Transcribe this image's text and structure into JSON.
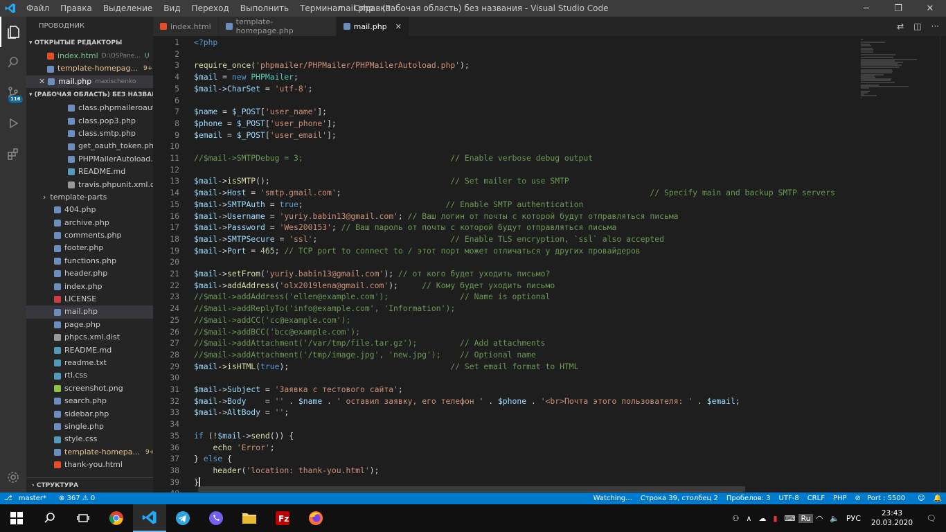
{
  "window": {
    "title": "mail.php - (Рабочая область) без названия - Visual Studio Code",
    "menu": [
      "Файл",
      "Правка",
      "Выделение",
      "Вид",
      "Переход",
      "Выполнить",
      "Терминал",
      "Справка"
    ]
  },
  "activity": {
    "scm_badge": "116"
  },
  "sidebar": {
    "title": "ПРОВОДНИК",
    "open_editors_title": "ОТКРЫТЫЕ РЕДАКТОРЫ",
    "open_editors": [
      {
        "name": "index.html",
        "path": "D:\\OSPane...",
        "badge": "U",
        "color": "#e44d26"
      },
      {
        "name": "template-homepag...",
        "path": "",
        "badge": "9+",
        "color": "#6c8ebf"
      },
      {
        "name": "mail.php",
        "path": "maxischenko",
        "badge": "",
        "color": "#6c8ebf"
      }
    ],
    "workspace_title": "(РАБОЧАЯ ОБЛАСТЬ) БЕЗ НАЗВАН...",
    "files": [
      {
        "name": "class.phpmaileroauthgo...",
        "indent": 60,
        "color": "#6c8ebf",
        "badge": ""
      },
      {
        "name": "class.pop3.php",
        "indent": 60,
        "color": "#6c8ebf",
        "badge": ""
      },
      {
        "name": "class.smtp.php",
        "indent": 60,
        "color": "#6c8ebf",
        "badge": ""
      },
      {
        "name": "get_oauth_token.php",
        "indent": 60,
        "color": "#6c8ebf",
        "badge": ""
      },
      {
        "name": "PHPMailerAutoload.php",
        "indent": 60,
        "color": "#6c8ebf",
        "badge": ""
      },
      {
        "name": "README.md",
        "indent": 60,
        "color": "#519aba",
        "badge": ""
      },
      {
        "name": "travis.phpunit.xml.dist",
        "indent": 60,
        "color": "#999",
        "badge": ""
      },
      {
        "name": "template-parts",
        "indent": 24,
        "color": "",
        "badge": "",
        "folder": true
      },
      {
        "name": "404.php",
        "indent": 40,
        "color": "#6c8ebf",
        "badge": ""
      },
      {
        "name": "archive.php",
        "indent": 40,
        "color": "#6c8ebf",
        "badge": ""
      },
      {
        "name": "comments.php",
        "indent": 40,
        "color": "#6c8ebf",
        "badge": ""
      },
      {
        "name": "footer.php",
        "indent": 40,
        "color": "#6c8ebf",
        "badge": ""
      },
      {
        "name": "functions.php",
        "indent": 40,
        "color": "#6c8ebf",
        "badge": ""
      },
      {
        "name": "header.php",
        "indent": 40,
        "color": "#6c8ebf",
        "badge": ""
      },
      {
        "name": "index.php",
        "indent": 40,
        "color": "#6c8ebf",
        "badge": ""
      },
      {
        "name": "LICENSE",
        "indent": 40,
        "color": "#cc3e44",
        "badge": ""
      },
      {
        "name": "mail.php",
        "indent": 40,
        "color": "#6c8ebf",
        "badge": "",
        "selected": true
      },
      {
        "name": "page.php",
        "indent": 40,
        "color": "#6c8ebf",
        "badge": ""
      },
      {
        "name": "phpcs.xml.dist",
        "indent": 40,
        "color": "#999",
        "badge": ""
      },
      {
        "name": "README.md",
        "indent": 40,
        "color": "#519aba",
        "badge": ""
      },
      {
        "name": "readme.txt",
        "indent": 40,
        "color": "#519aba",
        "badge": ""
      },
      {
        "name": "rtl.css",
        "indent": 40,
        "color": "#519aba",
        "badge": ""
      },
      {
        "name": "screenshot.png",
        "indent": 40,
        "color": "#8dc149",
        "badge": ""
      },
      {
        "name": "search.php",
        "indent": 40,
        "color": "#6c8ebf",
        "badge": ""
      },
      {
        "name": "sidebar.php",
        "indent": 40,
        "color": "#6c8ebf",
        "badge": ""
      },
      {
        "name": "single.php",
        "indent": 40,
        "color": "#6c8ebf",
        "badge": ""
      },
      {
        "name": "style.css",
        "indent": 40,
        "color": "#519aba",
        "badge": ""
      },
      {
        "name": "template-homepa...",
        "indent": 40,
        "color": "#6c8ebf",
        "badge": "9+",
        "dirty": true
      },
      {
        "name": "thank-you.html",
        "indent": 40,
        "color": "#e44d26",
        "badge": ""
      }
    ],
    "outline_title": "СТРУКТУРА"
  },
  "tabs": [
    {
      "label": "index.html",
      "color": "#e44d26",
      "active": false
    },
    {
      "label": "template-homepage.php",
      "color": "#6c8ebf",
      "active": false
    },
    {
      "label": "mail.php",
      "color": "#6c8ebf",
      "active": true
    }
  ],
  "editor": {
    "lines": [
      [
        [
          "k",
          "<?php"
        ]
      ],
      [],
      [
        [
          "f",
          "require_once"
        ],
        [
          "p",
          "("
        ],
        [
          "s",
          "'phpmailer/PHPMailer/PHPMailerAutoload.php'"
        ],
        [
          "p",
          ");"
        ]
      ],
      [
        [
          "v",
          "$mail"
        ],
        [
          "p",
          " = "
        ],
        [
          "k",
          "new"
        ],
        [
          "p",
          " "
        ],
        [
          "t",
          "PHPMailer"
        ],
        [
          "p",
          ";"
        ]
      ],
      [
        [
          "v",
          "$mail"
        ],
        [
          "p",
          "->"
        ],
        [
          "v",
          "CharSet"
        ],
        [
          "p",
          " = "
        ],
        [
          "s",
          "'utf-8'"
        ],
        [
          "p",
          ";"
        ]
      ],
      [],
      [
        [
          "v",
          "$name"
        ],
        [
          "p",
          " = "
        ],
        [
          "v",
          "$_POST"
        ],
        [
          "p",
          "["
        ],
        [
          "s",
          "'user_name'"
        ],
        [
          "p",
          "];"
        ]
      ],
      [
        [
          "v",
          "$phone"
        ],
        [
          "p",
          " = "
        ],
        [
          "v",
          "$_POST"
        ],
        [
          "p",
          "["
        ],
        [
          "s",
          "'user_phone'"
        ],
        [
          "p",
          "];"
        ]
      ],
      [
        [
          "v",
          "$email"
        ],
        [
          "p",
          " = "
        ],
        [
          "v",
          "$_POST"
        ],
        [
          "p",
          "["
        ],
        [
          "s",
          "'user_email'"
        ],
        [
          "p",
          "];"
        ]
      ],
      [],
      [
        [
          "c",
          "//$mail->SMTPDebug = 3;                               // Enable verbose debug output"
        ]
      ],
      [],
      [
        [
          "v",
          "$mail"
        ],
        [
          "p",
          "->"
        ],
        [
          "f",
          "isSMTP"
        ],
        [
          "p",
          "();                                      "
        ],
        [
          "c",
          "// Set mailer to use SMTP"
        ]
      ],
      [
        [
          "v",
          "$mail"
        ],
        [
          "p",
          "->"
        ],
        [
          "v",
          "Host"
        ],
        [
          "p",
          " = "
        ],
        [
          "s",
          "'smtp.gmail.com'"
        ],
        [
          "p",
          ";                                                                 "
        ],
        [
          "c",
          "// Specify main and backup SMTP servers"
        ]
      ],
      [
        [
          "v",
          "$mail"
        ],
        [
          "p",
          "->"
        ],
        [
          "v",
          "SMTPAuth"
        ],
        [
          "p",
          " = "
        ],
        [
          "k",
          "true"
        ],
        [
          "p",
          ";                              "
        ],
        [
          "c",
          "// Enable SMTP authentication"
        ]
      ],
      [
        [
          "v",
          "$mail"
        ],
        [
          "p",
          "->"
        ],
        [
          "v",
          "Username"
        ],
        [
          "p",
          " = "
        ],
        [
          "s",
          "'yuriy.babin13@gmail.com'"
        ],
        [
          "p",
          "; "
        ],
        [
          "c",
          "// Ваш логин от почты с которой будут отправляться письма"
        ]
      ],
      [
        [
          "v",
          "$mail"
        ],
        [
          "p",
          "->"
        ],
        [
          "v",
          "Password"
        ],
        [
          "p",
          " = "
        ],
        [
          "s",
          "'Wes200153'"
        ],
        [
          "p",
          "; "
        ],
        [
          "c",
          "// Ваш пароль от почты с которой будут отправляться письма"
        ]
      ],
      [
        [
          "v",
          "$mail"
        ],
        [
          "p",
          "->"
        ],
        [
          "v",
          "SMTPSecure"
        ],
        [
          "p",
          " = "
        ],
        [
          "s",
          "'ssl'"
        ],
        [
          "p",
          ";                            "
        ],
        [
          "c",
          "// Enable TLS encryption, `ssl` also accepted"
        ]
      ],
      [
        [
          "v",
          "$mail"
        ],
        [
          "p",
          "->"
        ],
        [
          "v",
          "Port"
        ],
        [
          "p",
          " = "
        ],
        [
          "n",
          "465"
        ],
        [
          "p",
          "; "
        ],
        [
          "c",
          "// TCP port to connect to / этот порт может отличаться у других провайдеров"
        ]
      ],
      [],
      [
        [
          "v",
          "$mail"
        ],
        [
          "p",
          "->"
        ],
        [
          "f",
          "setFrom"
        ],
        [
          "p",
          "("
        ],
        [
          "s",
          "'yuriy.babin13@gmail.com'"
        ],
        [
          "p",
          "); "
        ],
        [
          "c",
          "// от кого будет уходить письмо?"
        ]
      ],
      [
        [
          "v",
          "$mail"
        ],
        [
          "p",
          "->"
        ],
        [
          "f",
          "addAddress"
        ],
        [
          "p",
          "("
        ],
        [
          "s",
          "'olx2019lena@gmail.com'"
        ],
        [
          "p",
          ");     "
        ],
        [
          "c",
          "// Кому будет уходить письмо"
        ]
      ],
      [
        [
          "c",
          "//$mail->addAddress('ellen@example.com');               // Name is optional"
        ]
      ],
      [
        [
          "c",
          "//$mail->addReplyTo('info@example.com', 'Information');"
        ]
      ],
      [
        [
          "c",
          "//$mail->addCC('cc@example.com');"
        ]
      ],
      [
        [
          "c",
          "//$mail->addBCC('bcc@example.com');"
        ]
      ],
      [
        [
          "c",
          "//$mail->addAttachment('/var/tmp/file.tar.gz');         // Add attachments"
        ]
      ],
      [
        [
          "c",
          "//$mail->addAttachment('/tmp/image.jpg', 'new.jpg');    // Optional name"
        ]
      ],
      [
        [
          "v",
          "$mail"
        ],
        [
          "p",
          "->"
        ],
        [
          "f",
          "isHTML"
        ],
        [
          "p",
          "("
        ],
        [
          "k",
          "true"
        ],
        [
          "p",
          ");                                  "
        ],
        [
          "c",
          "// Set email format to HTML"
        ]
      ],
      [],
      [
        [
          "v",
          "$mail"
        ],
        [
          "p",
          "->"
        ],
        [
          "v",
          "Subject"
        ],
        [
          "p",
          " = "
        ],
        [
          "s",
          "'Заявка с тестового сайта'"
        ],
        [
          "p",
          ";"
        ]
      ],
      [
        [
          "v",
          "$mail"
        ],
        [
          "p",
          "->"
        ],
        [
          "v",
          "Body"
        ],
        [
          "p",
          "    = "
        ],
        [
          "s",
          "''"
        ],
        [
          "p",
          " . "
        ],
        [
          "v",
          "$name"
        ],
        [
          "p",
          " . "
        ],
        [
          "s",
          "' оставил заявку, его телефон '"
        ],
        [
          "p",
          " . "
        ],
        [
          "v",
          "$phone"
        ],
        [
          "p",
          " . "
        ],
        [
          "s",
          "'<br>Почта этого пользователя: '"
        ],
        [
          "p",
          " . "
        ],
        [
          "v",
          "$email"
        ],
        [
          "p",
          ";"
        ]
      ],
      [
        [
          "v",
          "$mail"
        ],
        [
          "p",
          "->"
        ],
        [
          "v",
          "AltBody"
        ],
        [
          "p",
          " = "
        ],
        [
          "s",
          "''"
        ],
        [
          "p",
          ";"
        ]
      ],
      [],
      [
        [
          "k",
          "if"
        ],
        [
          "p",
          " (!"
        ],
        [
          "v",
          "$mail"
        ],
        [
          "p",
          "->"
        ],
        [
          "f",
          "send"
        ],
        [
          "p",
          "()) {"
        ]
      ],
      [
        [
          "p",
          "    "
        ],
        [
          "f",
          "echo"
        ],
        [
          "p",
          " "
        ],
        [
          "s",
          "'Error'"
        ],
        [
          "p",
          ";"
        ]
      ],
      [
        [
          "p",
          "} "
        ],
        [
          "k",
          "else"
        ],
        [
          "p",
          " {"
        ]
      ],
      [
        [
          "p",
          "    "
        ],
        [
          "f",
          "header"
        ],
        [
          "p",
          "("
        ],
        [
          "s",
          "'location: thank-you.html'"
        ],
        [
          "p",
          ");"
        ]
      ],
      [
        [
          "p",
          "}"
        ]
      ],
      []
    ]
  },
  "status": {
    "branch": "master*",
    "problems": "⊗ 367 ⚠ 0",
    "watching": "Watching...",
    "position": "Строка 39, столбец 2",
    "spaces": "Пробелов: 3",
    "encoding": "UTF-8",
    "eol": "CRLF",
    "language": "PHP",
    "port": "Port : 5500"
  },
  "taskbar": {
    "lang": "РУС",
    "time": "23:43",
    "date": "20.03.2020",
    "tray_ru": "Ru"
  }
}
